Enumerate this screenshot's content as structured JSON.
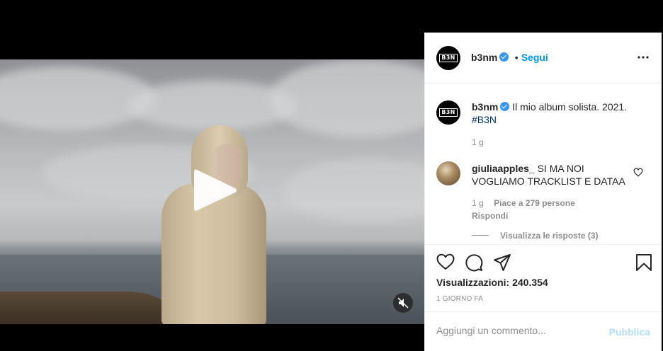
{
  "post": {
    "username": "b3nm",
    "follow_label": "Segui",
    "separator": "•",
    "avatar_logo": "B3N",
    "caption": "Il mio album solista. 2021.",
    "hashtag": "#B3N",
    "caption_age": "1 g",
    "views_label": "Visualizzazioni: 240.354",
    "time_ago": "1 GIORNO FA"
  },
  "comments": [
    {
      "username": "giuliaapples_",
      "text": "SI MA NOI VOGLIAMO TRACKLIST E DATAA",
      "age": "1 g",
      "likes": "Piace a 279 persone",
      "reply_label": "Rispondi",
      "view_replies": "Visualizza le risposte (3)"
    }
  ],
  "add_comment": {
    "placeholder": "Aggiungi un commento...",
    "publish_label": "Pubblica"
  },
  "icons": {
    "like": "heart-icon",
    "comment": "comment-icon",
    "share": "paper-plane-icon",
    "save": "bookmark-icon",
    "more": "more-options-icon",
    "play": "play-icon",
    "mute": "muted-speaker-icon",
    "verified": "verified-badge-icon"
  },
  "colors": {
    "accent": "#0095f6",
    "verified": "#3897f0",
    "publish_disabled": "#b2dffc",
    "secondary_text": "#8e8e8e"
  }
}
